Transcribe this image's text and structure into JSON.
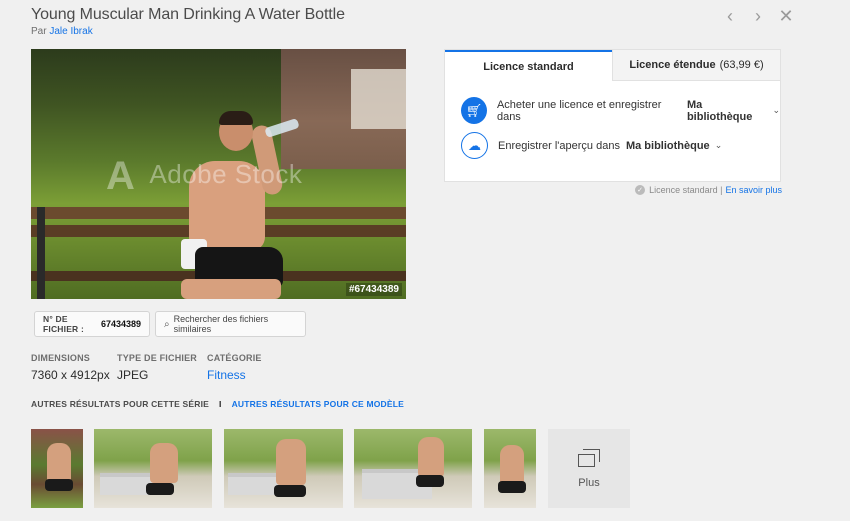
{
  "header": {
    "title": "Young Muscular Man Drinking A Water Bottle",
    "by_prefix": "Par",
    "author": "Jale Ibrak"
  },
  "nav": {
    "prev_icon": "chevron-left-icon",
    "next_icon": "chevron-right-icon",
    "close_icon": "close-icon"
  },
  "photo": {
    "watermark": "Adobe Stock",
    "id_tag": "#67434389"
  },
  "licence": {
    "tabs": [
      {
        "label": "Licence standard",
        "active": true
      },
      {
        "label": "Licence étendue",
        "price": "(63,99 €)",
        "active": false
      }
    ],
    "actions": [
      {
        "icon": "cart-add-icon",
        "text": "Acheter une licence et enregistrer dans",
        "target": "Ma bibliothèque"
      },
      {
        "icon": "cloud-download-icon",
        "text": "Enregistrer l'aperçu dans",
        "target": "Ma bibliothèque"
      }
    ],
    "note": "Licence standard |",
    "note_link": "En savoir plus"
  },
  "buttons": {
    "file_label": "N° DE FICHIER :",
    "file_id": "67434389",
    "similar": "Rechercher des fichiers similaires"
  },
  "meta": [
    {
      "key": "DIMENSIONS",
      "value": "7360 x 4912px"
    },
    {
      "key": "TYPE DE FICHIER",
      "value": "JPEG"
    },
    {
      "key": "CATÉGORIE",
      "value": "Fitness"
    }
  ],
  "series": {
    "series_label": "AUTRES RÉSULTATS POUR CETTE SÉRIE",
    "separator": "I",
    "model_label": "AUTRES RÉSULTATS POUR CE MODÈLE"
  },
  "more": {
    "label": "Plus",
    "icon": "stack-icon"
  },
  "colors": {
    "accent": "#1473e6",
    "background": "#f0f0f0"
  }
}
